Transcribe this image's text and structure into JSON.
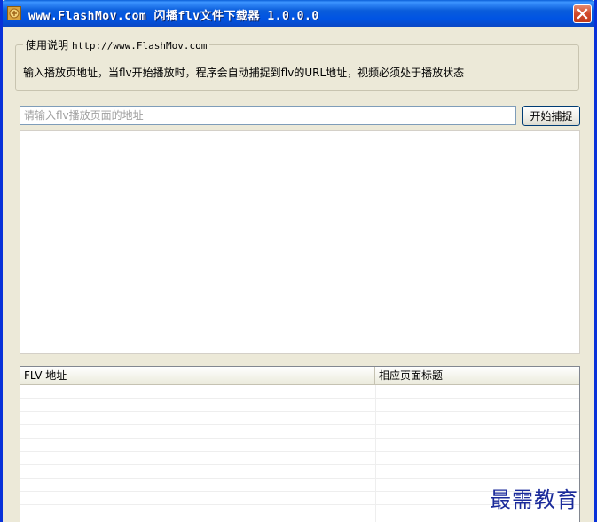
{
  "window": {
    "title": "www.FlashMov.com 闪播flv文件下载器 1.0.0.0"
  },
  "instructions": {
    "legend": "使用说明",
    "legend_url": "http://www.FlashMov.com",
    "text": "输入播放页地址，当flv开始播放时，程序会自动捕捉到flv的URL地址，视频必须处于播放状态"
  },
  "capture": {
    "input_value": "",
    "input_placeholder": "请输入flv播放页面的地址",
    "button_label": "开始捕捉"
  },
  "list": {
    "columns": [
      "FLV 地址",
      "相应页面标题"
    ],
    "rows": []
  },
  "watermark": "最需教育",
  "colors": {
    "titlebar": "#0054e3",
    "window_bg": "#ece9d8",
    "close_button": "#d14a2a",
    "watermark": "#1a2a9a"
  },
  "icons": {
    "app": "flash-app-icon",
    "close": "close-icon"
  }
}
